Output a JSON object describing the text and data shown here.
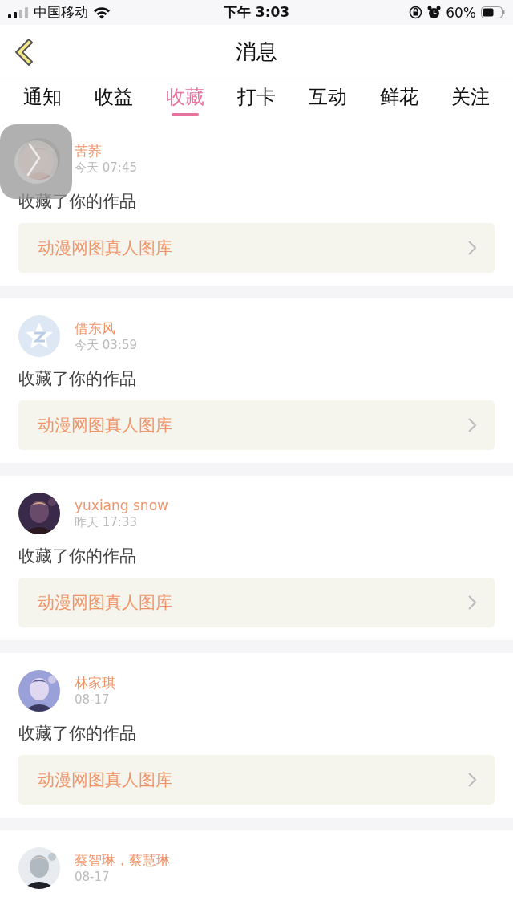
{
  "status_bar": {
    "carrier": "中国移动",
    "time": "下午 3:03",
    "battery_percent": "60%"
  },
  "nav": {
    "title": "消息"
  },
  "tabs": [
    {
      "label": "通知",
      "selected": false
    },
    {
      "label": "收益",
      "selected": false
    },
    {
      "label": "收藏",
      "selected": true
    },
    {
      "label": "打卡",
      "selected": false
    },
    {
      "label": "互动",
      "selected": false
    },
    {
      "label": "鲜花",
      "selected": false
    },
    {
      "label": "关注",
      "selected": false
    }
  ],
  "messages": [
    {
      "user": "苦荞",
      "time": "今天 07:45",
      "action": "收藏了你的作品",
      "work": "动漫网图真人图库"
    },
    {
      "user": "借东风",
      "time": "今天 03:59",
      "avatar": {
        "kind": "default"
      },
      "action": "收藏了你的作品",
      "work": "动漫网图真人图库"
    },
    {
      "user": "yuxiang snow",
      "time": "昨天 17:33",
      "action": "收藏了你的作品",
      "work": "动漫网图真人图库"
    },
    {
      "user": "林家琪",
      "time": "08-17",
      "action": "收藏了你的作品",
      "work": "动漫网图真人图库"
    },
    {
      "user": "蔡智琳，蔡慧琳",
      "time": "08-17"
    }
  ]
}
